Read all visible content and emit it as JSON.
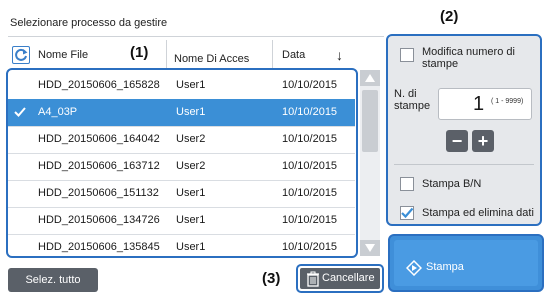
{
  "header": {
    "title": "Selezionare processo da gestire"
  },
  "callouts": {
    "one": "(1)",
    "two": "(2)",
    "three": "(3)"
  },
  "columns": {
    "file": "Nome File",
    "user": "Nome Di Acces",
    "date": "Data",
    "sort_arrow": "↓"
  },
  "rows": [
    {
      "file": "HDD_20150606_165828",
      "user": "User1",
      "date": "10/10/2015",
      "selected": false
    },
    {
      "file": "A4_03P",
      "user": "User1",
      "date": "10/10/2015",
      "selected": true
    },
    {
      "file": "HDD_20150606_164042",
      "user": "User2",
      "date": "10/10/2015",
      "selected": false
    },
    {
      "file": "HDD_20150606_163712",
      "user": "User2",
      "date": "10/10/2015",
      "selected": false
    },
    {
      "file": "HDD_20150606_151132",
      "user": "User1",
      "date": "10/10/2015",
      "selected": false
    },
    {
      "file": "HDD_20150606_134726",
      "user": "User1",
      "date": "10/10/2015",
      "selected": false
    },
    {
      "file": "HDD_20150606_135845",
      "user": "User1",
      "date": "10/10/2015",
      "selected": false
    }
  ],
  "settings": {
    "modify_copies_label": "Modifica numero di stampe",
    "copies_label": "N. di stampe",
    "copies_value": "1",
    "copies_range": "( 1 - 9999)",
    "minus": "−",
    "plus": "+",
    "bw_label": "Stampa B/N",
    "bw_checked": false,
    "delete_label": "Stampa ed elimina dati",
    "delete_checked": true
  },
  "buttons": {
    "print": "Stampa",
    "select_all": "Selez. tutto",
    "cancel": "Cancellare"
  },
  "icons": {
    "refresh": "refresh-icon",
    "check": "checkmark-icon",
    "trash": "trash-icon",
    "print": "print-diamond-icon",
    "scroll_up": "triangle-up-icon",
    "scroll_down": "triangle-down-icon"
  },
  "colors": {
    "accent": "#2b6fc0",
    "selected_row": "#3b8fd6",
    "button_dark": "#5a6068",
    "print_button": "#4a9be3"
  }
}
